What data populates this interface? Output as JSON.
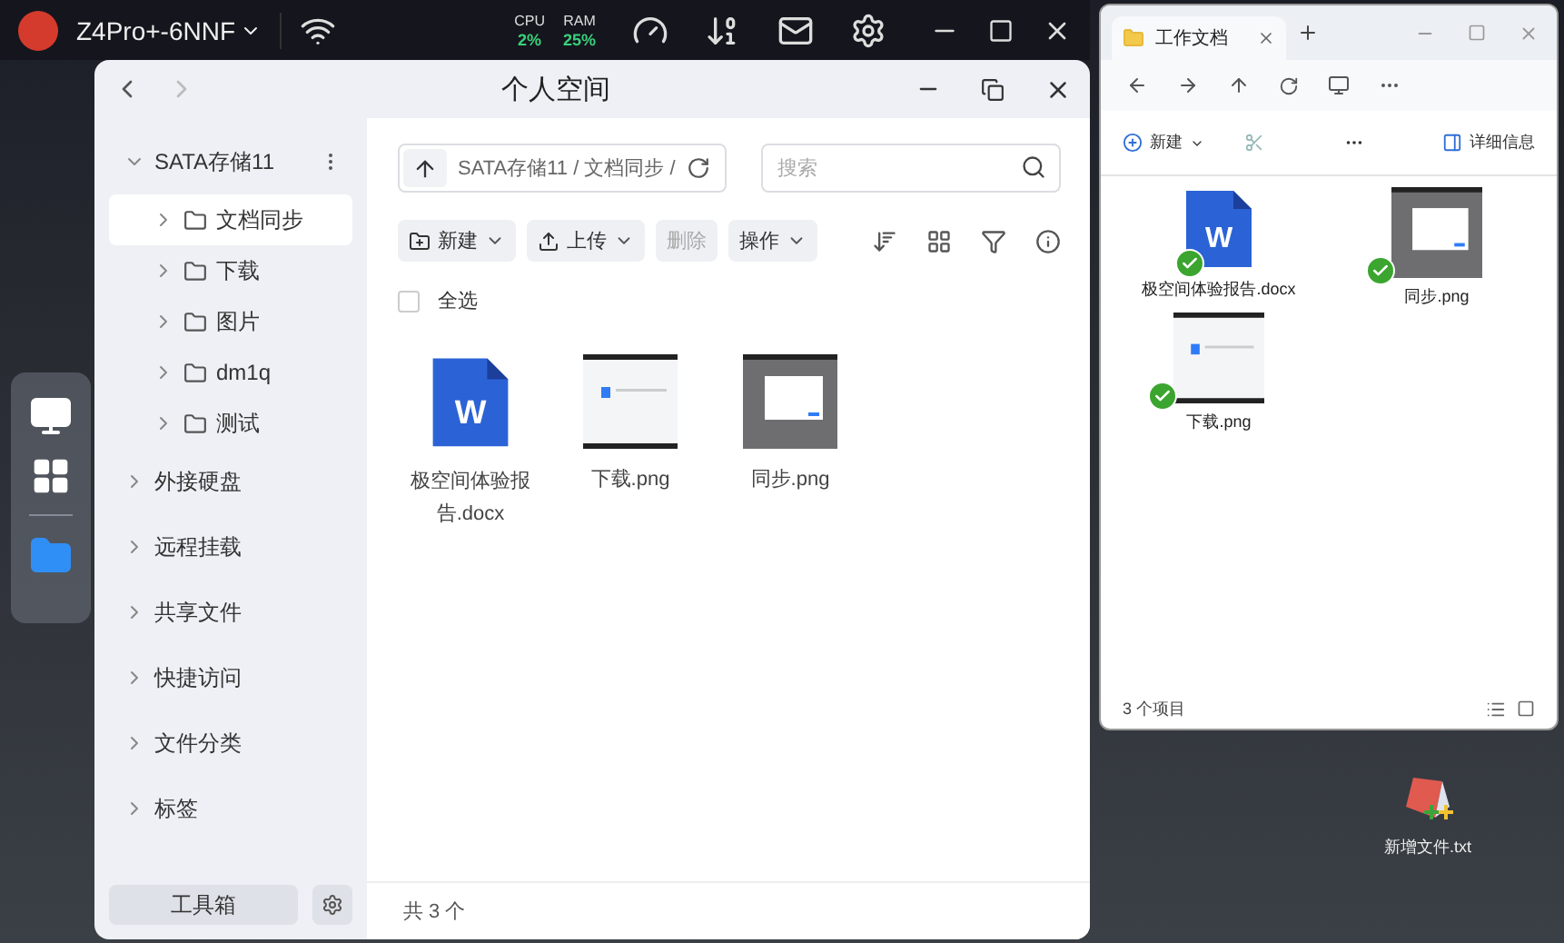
{
  "top_bar": {
    "device": "Z4Pro+-6NNF",
    "cpu": {
      "label": "CPU",
      "value": "2%"
    },
    "ram": {
      "label": "RAM",
      "value": "25%"
    }
  },
  "main_window": {
    "title": "个人空间",
    "sidebar": {
      "items": [
        {
          "label": "SATA存储11",
          "expanded": true,
          "selected": false,
          "children": [
            {
              "label": "文档同步",
              "expanded": false,
              "selected": true
            },
            {
              "label": "下载",
              "expanded": false,
              "selected": false
            },
            {
              "label": "图片",
              "expanded": false,
              "selected": false
            },
            {
              "label": "dm1q",
              "expanded": false,
              "selected": false
            },
            {
              "label": "测试",
              "expanded": false,
              "selected": false
            }
          ]
        },
        {
          "label": "外接硬盘",
          "expanded": false,
          "selected": false
        },
        {
          "label": "远程挂载",
          "expanded": false,
          "selected": false
        },
        {
          "label": "共享文件",
          "expanded": false,
          "selected": false
        },
        {
          "label": "快捷访问",
          "expanded": false,
          "selected": false
        },
        {
          "label": "文件分类",
          "expanded": false,
          "selected": false
        },
        {
          "label": "标签",
          "expanded": false,
          "selected": false
        }
      ],
      "toolbox": "工具箱"
    },
    "path": "SATA存储11 / 文档同步 /",
    "search": {
      "placeholder": "搜索"
    },
    "toolbar": [
      {
        "label": "新建",
        "kind": "new",
        "dropdown": true,
        "disabled": false
      },
      {
        "label": "上传",
        "kind": "upload",
        "dropdown": true,
        "disabled": false
      },
      {
        "label": "删除",
        "kind": "plain",
        "dropdown": false,
        "disabled": true
      },
      {
        "label": "操作",
        "kind": "plain",
        "dropdown": true,
        "disabled": false
      }
    ],
    "select_all": {
      "label": "全选",
      "checked": false
    },
    "files": [
      {
        "name": "极空间体验报告.docx",
        "kind": "doc",
        "icon_letter": "W"
      },
      {
        "name": "下载.png",
        "kind": "light-shot"
      },
      {
        "name": "同步.png",
        "kind": "dialog-shot"
      }
    ],
    "footer": "共 3 个"
  },
  "explorer": {
    "tab": "工作文档",
    "new_label": "新建",
    "details": "详细信息",
    "files": [
      {
        "name": "极空间体验报告.docx",
        "kind": "doc",
        "icon_letter": "W",
        "synced": true
      },
      {
        "name": "同步.png",
        "kind": "dialog-shot",
        "synced": true
      },
      {
        "name": "下载.png",
        "kind": "light-shot",
        "synced": true
      }
    ],
    "status": "3 个项目"
  },
  "desktop_icons": [
    {
      "label": "新增文件.txt"
    }
  ]
}
